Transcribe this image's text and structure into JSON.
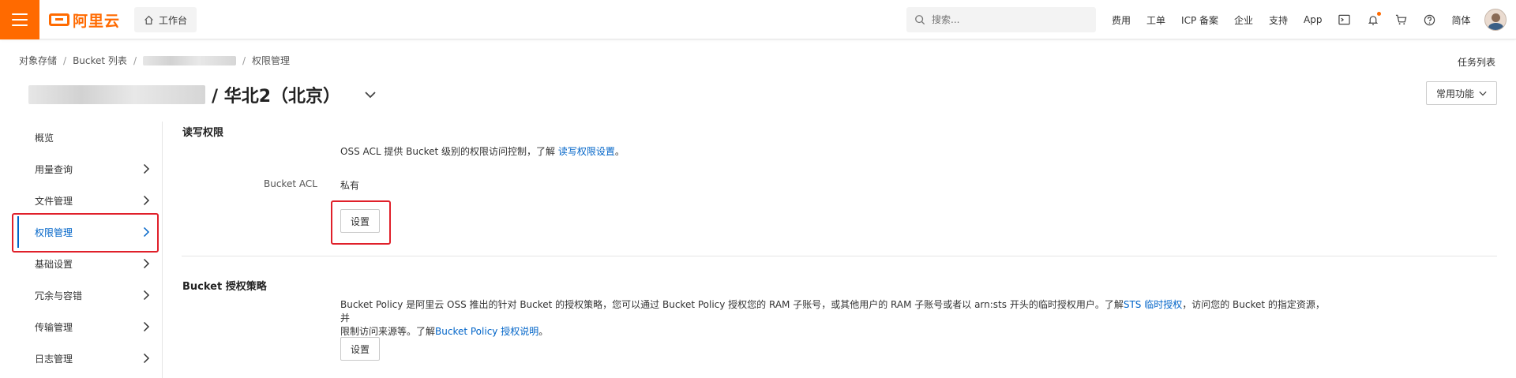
{
  "topbar": {
    "logo_text": "阿里云",
    "workbench_label": "工作台",
    "search_placeholder": "搜索...",
    "links": [
      "费用",
      "工单",
      "ICP 备案",
      "企业",
      "支持",
      "App"
    ],
    "language": "简体",
    "accent_color": "#ff6a00",
    "icons": [
      "terminal-icon",
      "bell-icon",
      "cart-icon",
      "help-icon"
    ]
  },
  "breadcrumb": {
    "items": [
      "对象存储",
      "Bucket 列表",
      "权限管理"
    ]
  },
  "task_list": "任务列表",
  "page": {
    "title_suffix": "/ 华北2（北京）",
    "common_functions": "常用功能"
  },
  "sidebar": {
    "items": [
      {
        "label": "概览",
        "has_chevron": false,
        "active": false
      },
      {
        "label": "用量查询",
        "has_chevron": true,
        "active": false
      },
      {
        "label": "文件管理",
        "has_chevron": true,
        "active": false
      },
      {
        "label": "权限管理",
        "has_chevron": true,
        "active": true
      },
      {
        "label": "基础设置",
        "has_chevron": true,
        "active": false
      },
      {
        "label": "冗余与容错",
        "has_chevron": true,
        "active": false
      },
      {
        "label": "传输管理",
        "has_chevron": true,
        "active": false
      },
      {
        "label": "日志管理",
        "has_chevron": true,
        "active": false
      }
    ],
    "active_color": "#0064c8",
    "highlight_color": "#e0202a"
  },
  "acl_section": {
    "title": "读写权限",
    "desc_text": "OSS ACL 提供 Bucket 级别的权限访问控制，了解",
    "desc_link": "读写权限设置",
    "desc_end": "。",
    "field_label": "Bucket ACL",
    "field_value": "私有",
    "button_label": "设置"
  },
  "policy_section": {
    "title": "Bucket 授权策略",
    "desc_line1_a": "Bucket Policy 是阿里云 OSS 推出的针对 Bucket 的授权策略，您可以通过 Bucket Policy 授权您的 RAM 子账号，或其他用户的 RAM 子账号或者以 arn:sts 开头的临时授权用户。了解",
    "desc_line1_link": "STS 临时授权",
    "desc_line1_b": "，访问您的 Bucket 的指定资源，并",
    "desc_line2_a": "限制访问来源等。了解",
    "desc_line2_link": "Bucket Policy 授权说明",
    "desc_line2_b": "。",
    "button_label": "设置"
  }
}
